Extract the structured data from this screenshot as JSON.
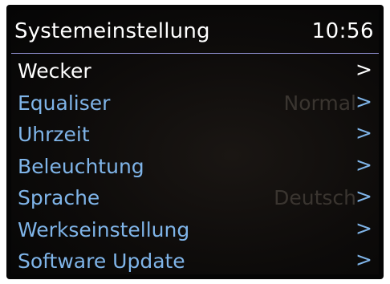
{
  "header": {
    "title": "Systemeinstellung",
    "clock": "10:56"
  },
  "menu": {
    "items": [
      {
        "label": "Wecker",
        "value": "",
        "arrow": ">",
        "selected": true
      },
      {
        "label": "Equaliser",
        "value": "Normal",
        "arrow": ">",
        "selected": false
      },
      {
        "label": "Uhrzeit",
        "value": "",
        "arrow": ">",
        "selected": false
      },
      {
        "label": "Beleuchtung",
        "value": "",
        "arrow": ">",
        "selected": false
      },
      {
        "label": "Sprache",
        "value": "Deutsch",
        "arrow": ">",
        "selected": false
      },
      {
        "label": "Werkseinstellung",
        "value": "",
        "arrow": ">",
        "selected": false
      },
      {
        "label": "Software Update",
        "value": "",
        "arrow": ">",
        "selected": false
      }
    ]
  },
  "colors": {
    "selected_text": "#ffffff",
    "item_text": "#7fb4e8",
    "value_text": "#3a3530",
    "header_divider": "#8f8fd0",
    "background": "#0d0b0a"
  }
}
